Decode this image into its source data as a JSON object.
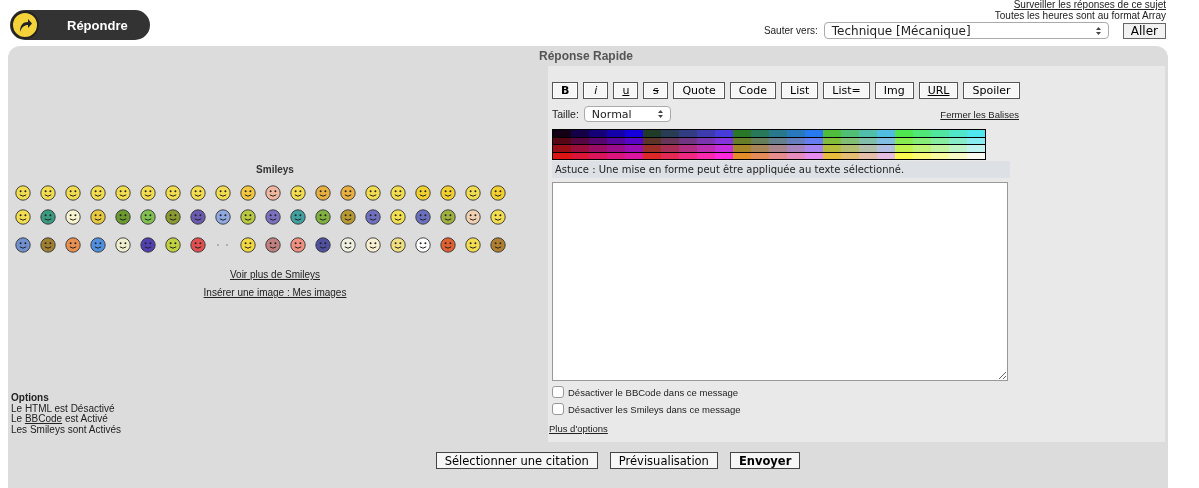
{
  "header": {
    "watch_link": "Surveiller les réponses de ce sujet",
    "timezone_note": "Toutes les heures sont au format Array"
  },
  "reply_button": {
    "label": "Répondre"
  },
  "jump": {
    "label": "Sauter vers:",
    "value": "Technique [Mécanique]",
    "button": "Aller"
  },
  "quick_reply": {
    "title": "Réponse Rapide",
    "smileys": {
      "title": "Smileys",
      "rows": [
        [
          {
            "kind": "face",
            "color": "#f2dc50"
          },
          {
            "kind": "face",
            "color": "#f2dc50"
          },
          {
            "kind": "face",
            "color": "#f2dc50"
          },
          {
            "kind": "face",
            "color": "#f2dc50"
          },
          {
            "kind": "face",
            "color": "#f2dc50"
          },
          {
            "kind": "face",
            "color": "#f2dc50"
          },
          {
            "kind": "face",
            "color": "#f2dc50"
          },
          {
            "kind": "face",
            "color": "#f2dc50"
          },
          {
            "kind": "face",
            "color": "#f2dc50"
          },
          {
            "kind": "face",
            "color": "#f2c840"
          },
          {
            "kind": "face",
            "color": "#f0b8a0"
          },
          {
            "kind": "face",
            "color": "#f2dc50"
          },
          {
            "kind": "face",
            "color": "#e8b040"
          },
          {
            "kind": "face",
            "color": "#e8b040"
          },
          {
            "kind": "face",
            "color": "#f2dc50"
          },
          {
            "kind": "face",
            "color": "#f2dc50"
          },
          {
            "kind": "face",
            "color": "#f2d030"
          },
          {
            "kind": "face",
            "color": "#f2d030"
          },
          {
            "kind": "face",
            "color": "#f2dc50"
          },
          {
            "kind": "face",
            "color": "#f2d030"
          }
        ],
        [
          {
            "kind": "face",
            "color": "#f2dc50"
          },
          {
            "kind": "face",
            "color": "#3a9a80"
          },
          {
            "kind": "face",
            "color": "#f8f4d0"
          },
          {
            "kind": "face",
            "color": "#e8c840"
          },
          {
            "kind": "face",
            "color": "#6a9a30"
          },
          {
            "kind": "face",
            "color": "#80c050"
          },
          {
            "kind": "face",
            "color": "#8a9a30"
          },
          {
            "kind": "face",
            "color": "#6a5ab0"
          },
          {
            "kind": "face",
            "color": "#90a8e0"
          },
          {
            "kind": "face",
            "color": "#b8c840"
          },
          {
            "kind": "face",
            "color": "#7a70c0"
          },
          {
            "kind": "face",
            "color": "#40a0a0"
          },
          {
            "kind": "face",
            "color": "#80b040"
          },
          {
            "kind": "face",
            "color": "#b89830"
          },
          {
            "kind": "face",
            "color": "#7070c0"
          },
          {
            "kind": "face",
            "color": "#f2e050"
          },
          {
            "kind": "face",
            "color": "#6a70c0"
          },
          {
            "kind": "face",
            "color": "#a0b040"
          },
          {
            "kind": "face",
            "color": "#f0d0b0"
          },
          {
            "kind": "face",
            "color": "#f2dc50"
          }
        ],
        [
          {
            "kind": "face",
            "color": "#7090d0"
          },
          {
            "kind": "face",
            "color": "#a08030"
          },
          {
            "kind": "face",
            "color": "#e89050"
          },
          {
            "kind": "face",
            "color": "#5090e0"
          },
          {
            "kind": "face",
            "color": "#f0f0d0"
          },
          {
            "kind": "face",
            "color": "#5040b0"
          },
          {
            "kind": "face",
            "color": "#c0d040"
          },
          {
            "kind": "face",
            "color": "#e05050"
          },
          {
            "kind": "dots"
          },
          {
            "kind": "face",
            "color": "#f2d840"
          },
          {
            "kind": "face",
            "color": "#c08080"
          },
          {
            "kind": "face",
            "color": "#f09080"
          },
          {
            "kind": "face",
            "color": "#5050a0"
          },
          {
            "kind": "face",
            "color": "#f0f0e0"
          },
          {
            "kind": "face",
            "color": "#f8f0d0"
          },
          {
            "kind": "face",
            "color": "#f0e080"
          },
          {
            "kind": "face",
            "color": "#ffffff"
          },
          {
            "kind": "face",
            "color": "#e06030"
          },
          {
            "kind": "face",
            "color": "#f2dc50"
          },
          {
            "kind": "face",
            "color": "#b08030"
          }
        ]
      ],
      "more_link": "Voir plus de Smileys",
      "insert_link": "Insérer une image : Mes images"
    },
    "options": {
      "title": "Options",
      "lines": [
        {
          "text": "Le HTML est Désactivé"
        },
        {
          "before": "Le ",
          "link": "BBCode",
          "text": " est Activé"
        },
        {
          "text": "Les Smileys sont Activés"
        }
      ]
    },
    "toolbar": [
      {
        "label": "B",
        "kind": "bold"
      },
      {
        "label": "i",
        "kind": "italic"
      },
      {
        "label": "u",
        "kind": "underline"
      },
      {
        "label": "s",
        "kind": "strike"
      },
      {
        "label": "Quote",
        "kind": "plain"
      },
      {
        "label": "Code",
        "kind": "plain"
      },
      {
        "label": "List",
        "kind": "plain"
      },
      {
        "label": "List=",
        "kind": "plain"
      },
      {
        "label": "Img",
        "kind": "plain"
      },
      {
        "label": "URL",
        "kind": "underline"
      },
      {
        "label": "Spoiler",
        "kind": "plain"
      }
    ],
    "size": {
      "label": "Taille:",
      "value": "Normal"
    },
    "close_tags": "Fermer les Balises",
    "tip": "Astuce : Une mise en forme peut être appliquée au texte sélectionné.",
    "checkboxes": [
      {
        "label": "Désactiver le BBCode dans ce message",
        "checked": false
      },
      {
        "label": "Désactiver les Smileys dans ce message",
        "checked": false
      }
    ],
    "more_options": "Plus d'options",
    "actions": [
      {
        "label": "Sélectionner une citation",
        "kind": "normal"
      },
      {
        "label": "Prévisualisation",
        "kind": "normal"
      },
      {
        "label": "Envoyer",
        "kind": "primary"
      }
    ]
  }
}
